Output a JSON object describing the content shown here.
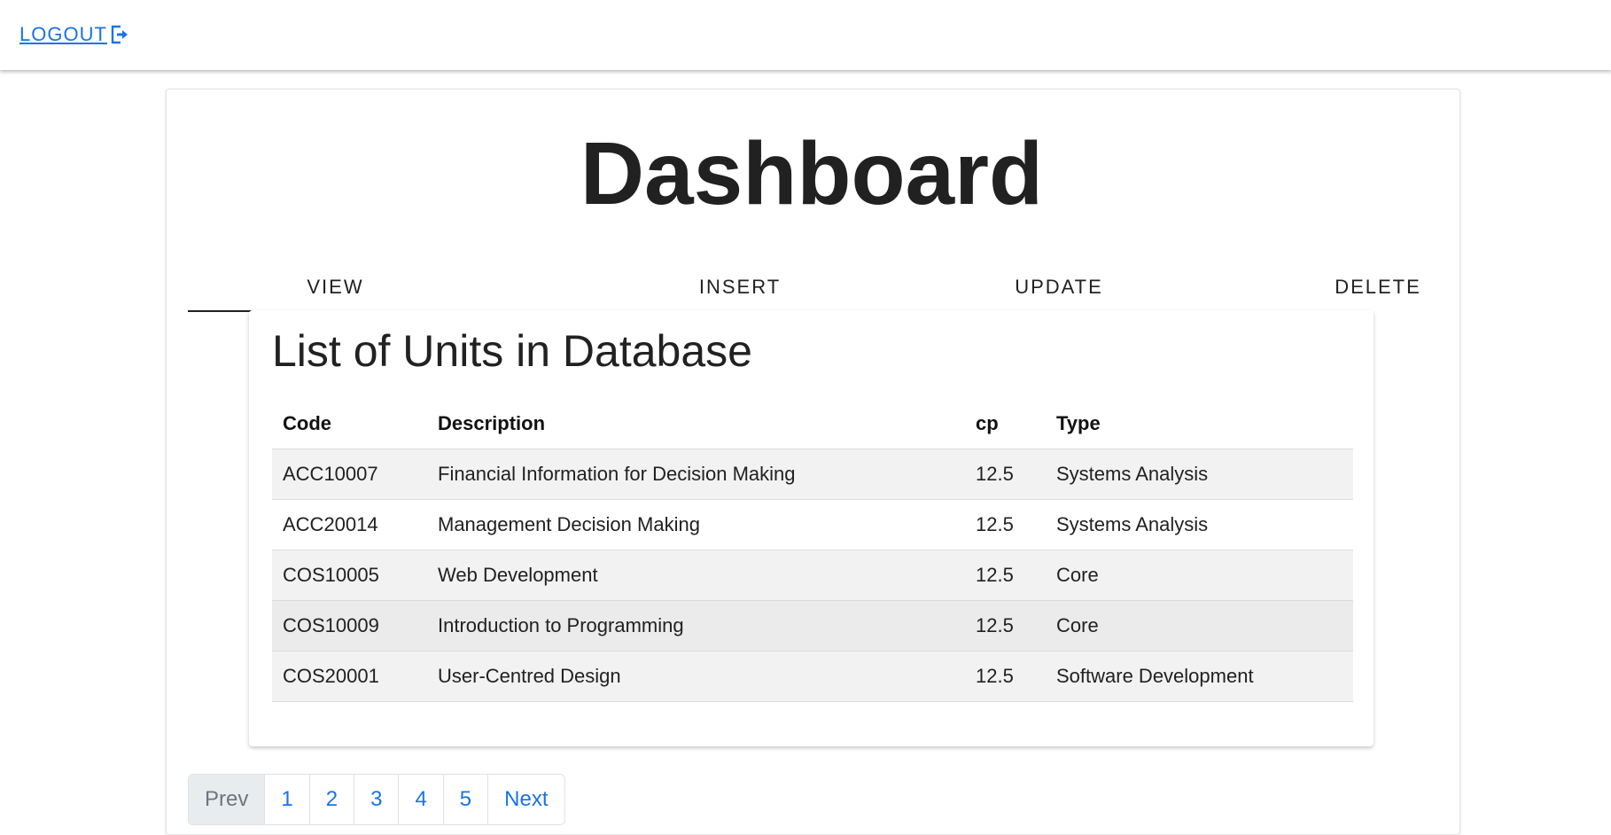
{
  "nav": {
    "logout_label": "LOGOUT"
  },
  "page": {
    "title": "Dashboard"
  },
  "tabs": [
    {
      "label": "VIEW",
      "active": true
    },
    {
      "label": "INSERT",
      "active": false
    },
    {
      "label": "UPDATE",
      "active": false
    },
    {
      "label": "DELETE",
      "active": false
    }
  ],
  "panel": {
    "title": "List of Units in Database"
  },
  "table": {
    "columns": [
      "Code",
      "Description",
      "cp",
      "Type"
    ],
    "rows": [
      [
        "ACC10007",
        "Financial Information for Decision Making",
        "12.5",
        "Systems Analysis"
      ],
      [
        "ACC20014",
        "Management Decision Making",
        "12.5",
        "Systems Analysis"
      ],
      [
        "COS10005",
        "Web Development",
        "12.5",
        "Core"
      ],
      [
        "COS10009",
        "Introduction to Programming",
        "12.5",
        "Core"
      ],
      [
        "COS20001",
        "User-Centred Design",
        "12.5",
        "Software Development"
      ]
    ]
  },
  "pagination": {
    "prev_label": "Prev",
    "pages": [
      "1",
      "2",
      "3",
      "4",
      "5"
    ],
    "next_label": "Next"
  },
  "colors": {
    "link": "#1a73e8",
    "text": "#212121",
    "row_stripe": "#f2f2f2",
    "disabled_bg": "#e9ecef"
  }
}
